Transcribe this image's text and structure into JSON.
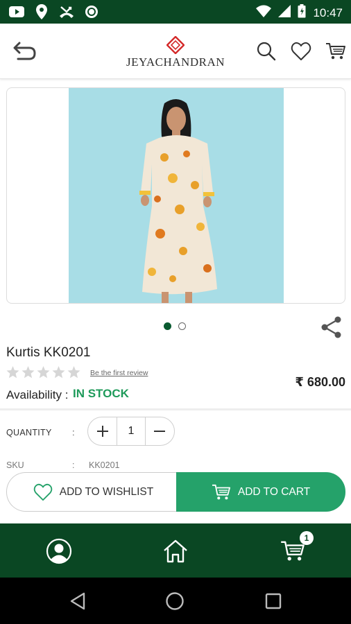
{
  "status_bar": {
    "time": "10:47",
    "left_icons": [
      "youtube-icon",
      "location-icon",
      "missed-call-icon",
      "sync-icon"
    ],
    "right_icons": [
      "wifi-icon",
      "signal-icon",
      "battery-icon"
    ]
  },
  "header": {
    "brand_name": "JEYACHANDRAN",
    "icons": [
      "back-icon",
      "search-icon",
      "heart-icon",
      "cart-icon"
    ]
  },
  "product": {
    "title": "Kurtis KK0201",
    "rating_stars": 5,
    "rating_filled": 0,
    "review_link": "Be the first review",
    "price": "₹ 680.00",
    "availability_label": "Availability :",
    "availability_value": "IN STOCK",
    "image_pages": 2,
    "current_page": 1
  },
  "quantity": {
    "label": "QUANTITY",
    "colon": ":",
    "value": "1"
  },
  "sku": {
    "label": "SKU",
    "colon": ":",
    "value": "KK0201"
  },
  "actions": {
    "wishlist_label": "ADD TO WISHLIST",
    "cart_label": "ADD TO CART"
  },
  "bottom_nav": {
    "items": [
      "profile-icon",
      "home-icon",
      "cart-icon"
    ],
    "cart_badge": "1"
  },
  "colors": {
    "brand_green": "#0a4723",
    "accent_green": "#25a26a",
    "stock_green": "#1e9a5a"
  }
}
